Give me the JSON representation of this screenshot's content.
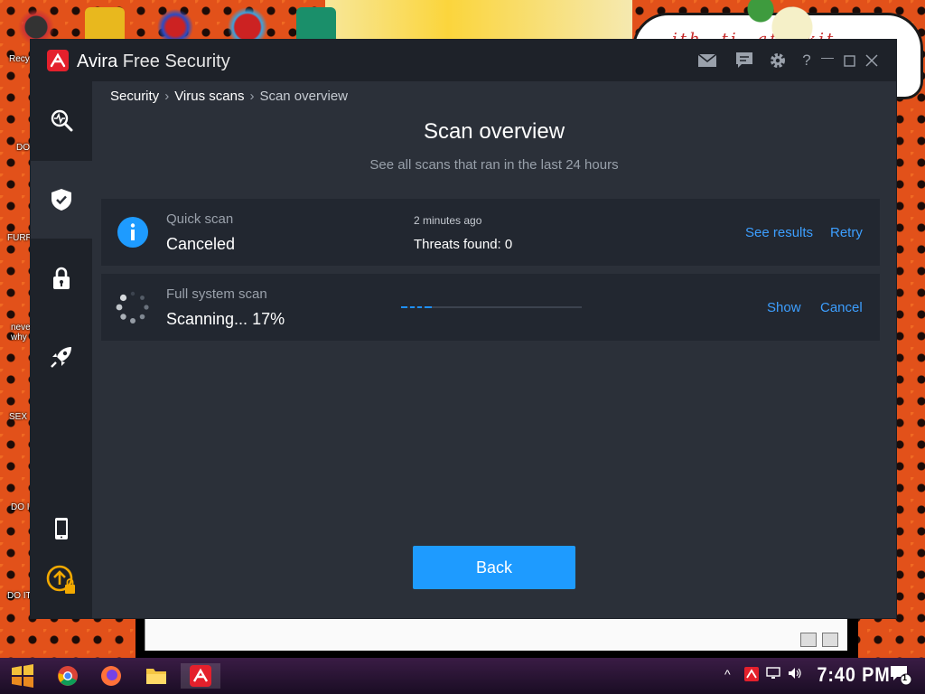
{
  "desktop": {
    "bubble_text": "…ith…ti…ati…kit",
    "labels": [
      "Recy",
      "DO",
      "FURR",
      "neve why",
      "SEX",
      "DO I",
      "DO IT"
    ]
  },
  "app": {
    "title_brand": "Avira",
    "title_product": "Free Security",
    "icons": {
      "mail": "mail-icon",
      "feedback": "feedback-icon",
      "settings": "gear-icon",
      "help": "?",
      "minimize": "—",
      "maximize": "☐",
      "close": "✕"
    }
  },
  "sidebar": {
    "items": [
      {
        "name": "status-icon",
        "active": false
      },
      {
        "name": "security-shield-icon",
        "active": true
      },
      {
        "name": "privacy-lock-icon",
        "active": false
      },
      {
        "name": "performance-rocket-icon",
        "active": false
      },
      {
        "name": "mobile-icon",
        "active": false
      },
      {
        "name": "upgrade-icon",
        "active": false
      }
    ]
  },
  "breadcrumb": {
    "items": [
      "Security",
      "Virus scans",
      "Scan overview"
    ]
  },
  "page": {
    "title": "Scan overview",
    "subtitle": "See all scans that ran in the last 24 hours"
  },
  "scans": [
    {
      "name": "Quick scan",
      "status": "Canceled",
      "time": "2 minutes ago",
      "threats": "Threats found: 0",
      "actions": [
        "See results",
        "Retry"
      ]
    },
    {
      "name": "Full system scan",
      "status": "Scanning... 17%",
      "progress_fraction": 0.17,
      "actions": [
        "Show",
        "Cancel"
      ]
    }
  ],
  "buttons": {
    "back": "Back"
  },
  "colors": {
    "accent": "#1e9bff",
    "link": "#3d9fff",
    "brand_red": "#e4202c",
    "panel": "#2b3039",
    "row": "#222730"
  },
  "taskbar": {
    "clock": "7:40 PM",
    "notification_count": "1"
  }
}
